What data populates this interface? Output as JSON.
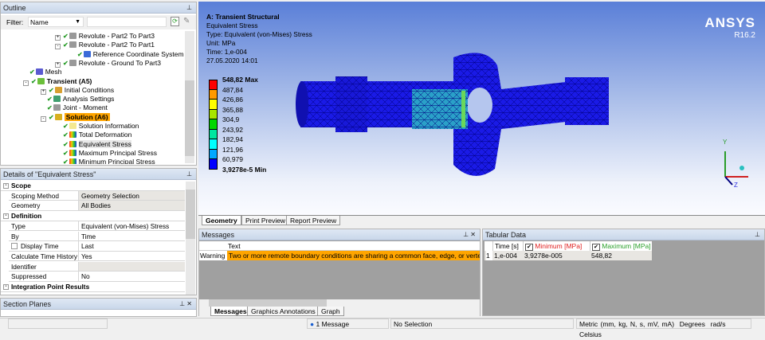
{
  "outline": {
    "title": "Outline",
    "filter_label": "Filter:",
    "filter_value": "Name",
    "filter_text": "",
    "items": [
      {
        "label": "Revolute - Part2 To Part3",
        "indent": 68,
        "expander": "+",
        "icon": "joint-icon"
      },
      {
        "label": "Revolute - Part2 To Part1",
        "indent": 68,
        "expander": "-",
        "icon": "joint-icon"
      },
      {
        "label": "Reference Coordinate System",
        "indent": 96,
        "expander": "",
        "icon": "coordinate-system-icon"
      },
      {
        "label": "Revolute - Ground To Part3",
        "indent": 68,
        "expander": "+",
        "icon": "joint-icon"
      },
      {
        "label": "Mesh",
        "indent": 36,
        "expander": "",
        "icon": "mesh-icon"
      },
      {
        "label": "Transient (A5)",
        "indent": 28,
        "expander": "-",
        "icon": "transient-icon",
        "bold": true
      },
      {
        "label": "Initial Conditions",
        "indent": 50,
        "expander": "+",
        "icon": "initial-conditions-icon"
      },
      {
        "label": "Analysis Settings",
        "indent": 58,
        "expander": "",
        "icon": "analysis-settings-icon"
      },
      {
        "label": "Joint - Moment",
        "indent": 58,
        "expander": "",
        "icon": "joint-icon"
      },
      {
        "label": "Solution (A6)",
        "indent": 50,
        "expander": "-",
        "icon": "solution-icon",
        "bold": true,
        "highlight": true
      },
      {
        "label": "Solution Information",
        "indent": 78,
        "expander": "",
        "icon": "info-icon"
      },
      {
        "label": "Total Deformation",
        "indent": 78,
        "expander": "",
        "icon": "result-icon"
      },
      {
        "label": "Equivalent Stress",
        "indent": 78,
        "expander": "",
        "icon": "result-icon",
        "selected": true
      },
      {
        "label": "Maximum Principal Stress",
        "indent": 78,
        "expander": "",
        "icon": "result-icon"
      },
      {
        "label": "Minimum Principal Stress",
        "indent": 78,
        "expander": "",
        "icon": "result-icon"
      }
    ]
  },
  "details": {
    "title": "Details of \"Equivalent Stress\"",
    "rows": [
      {
        "section": "Scope"
      },
      {
        "key": "Scoping Method",
        "value": "Geometry Selection",
        "gray": true
      },
      {
        "key": "Geometry",
        "value": "All Bodies",
        "gray": true
      },
      {
        "section": "Definition"
      },
      {
        "key": "Type",
        "value": "Equivalent (von-Mises) Stress"
      },
      {
        "key": "By",
        "value": "Time"
      },
      {
        "key": "Display Time",
        "value": "Last",
        "checkbox": true
      },
      {
        "key": "Calculate Time History",
        "value": "Yes"
      },
      {
        "key": "Identifier",
        "value": "",
        "gray": true
      },
      {
        "key": "Suppressed",
        "value": "No"
      },
      {
        "section": "Integration Point Results"
      }
    ]
  },
  "section_planes": {
    "title": "Section Planes"
  },
  "viewport": {
    "title": "A: Transient Structural",
    "lines": [
      "Equivalent Stress",
      "Type: Equivalent (von-Mises) Stress",
      "Unit: MPa",
      "Time: 1,e-004",
      "27.05.2020 14:01"
    ],
    "brand": "ANSYS",
    "version": "R16.2",
    "legend": {
      "labels": [
        "548,82 Max",
        "487,84",
        "426,86",
        "365,88",
        "304,9",
        "243,92",
        "182,94",
        "121,96",
        "60,979",
        "3,9278e-5 Min"
      ],
      "colors": [
        "#ff0000",
        "#ff9a00",
        "#ffff00",
        "#a8e600",
        "#00d800",
        "#00e6a0",
        "#00ffff",
        "#00a8ff",
        "#0000ff"
      ]
    },
    "axes": {
      "x": "X",
      "y": "Y",
      "z": "Z"
    },
    "tabs": [
      "Geometry",
      "Print Preview",
      "Report Preview"
    ],
    "active_tab": "Geometry"
  },
  "messages": {
    "title": "Messages",
    "col_text": "Text",
    "rows": [
      {
        "type": "Warning",
        "text": "Two or more remote boundary conditions are sharing a common face, edge, or vertex"
      }
    ],
    "tabs": [
      "Messages",
      "Graphics Annotations",
      "Graph"
    ]
  },
  "tabular": {
    "title": "Tabular Data",
    "headers": [
      "Time [s]",
      "Minimum [MPa]",
      "Maximum [MPa]"
    ],
    "rows": [
      [
        "1",
        "1,e-004",
        "3,9278e-005",
        "548,82"
      ]
    ],
    "min_color": "#e02020",
    "max_color": "#2aa02a"
  },
  "status": {
    "messages": "1 Message",
    "selection": "No Selection",
    "units": "Metric (mm, kg, N, s, mV, mA)",
    "angle": "Degrees",
    "rot": "rad/s",
    "temp": "Celsius"
  }
}
